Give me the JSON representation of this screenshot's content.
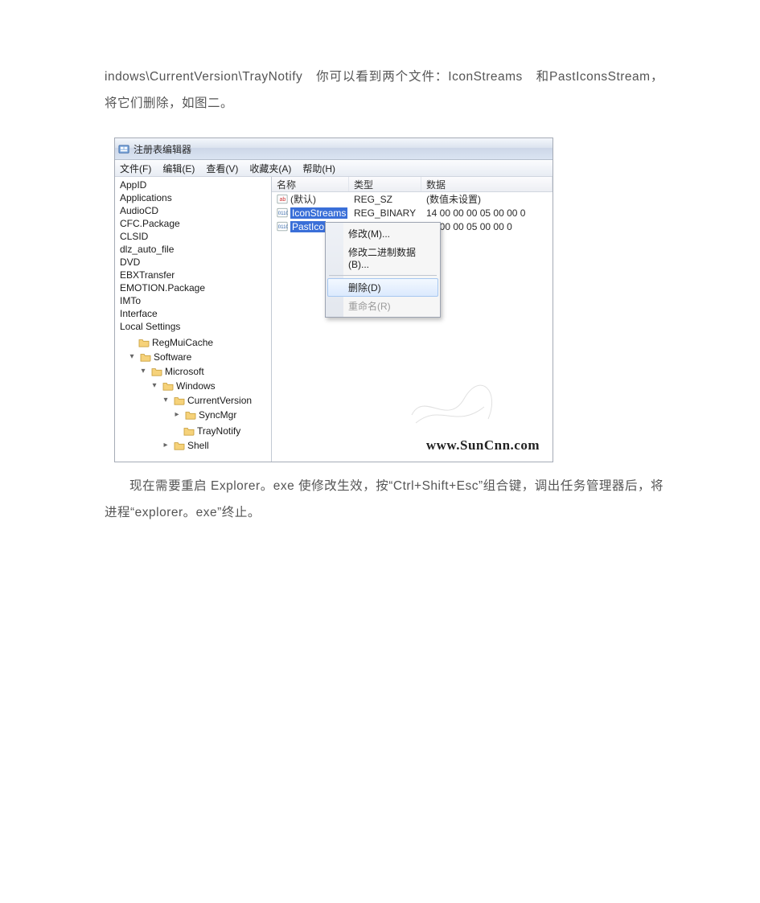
{
  "para1": "indows\\CurrentVersion\\TrayNotify　你可以看到两个文件：IconStreams　和PastIconsStream，将它们删除，如图二。",
  "para2": "现在需要重启 Explorer。exe 使修改生效，按“Ctrl+Shift+Esc”组合键，调出任务管理器后，将进程“explorer。exe”终止。",
  "regedit": {
    "title": "注册表编辑器",
    "menu": {
      "file": "文件(F)",
      "edit": "编辑(E)",
      "view": "查看(V)",
      "fav": "收藏夹(A)",
      "help": "帮助(H)"
    },
    "tree": [
      "AppID",
      "Applications",
      "AudioCD",
      "CFC.Package",
      "CLSID",
      "dlz_auto_file",
      "DVD",
      "EBXTransfer",
      "EMOTION.Package",
      "IMTo",
      "Interface",
      "Local Settings"
    ],
    "treeNested": {
      "regmui": "RegMuiCache",
      "software": "Software",
      "microsoft": "Microsoft",
      "windows": "Windows",
      "currentversion": "CurrentVersion",
      "syncmgr": "SyncMgr",
      "traynotify": "TrayNotify",
      "shell": "Shell"
    },
    "cols": {
      "name": "名称",
      "type": "类型",
      "data": "数据"
    },
    "rows": [
      {
        "name": "(默认)",
        "type": "REG_SZ",
        "data": "(数值未设置)"
      },
      {
        "name": "IconStreams",
        "type": "REG_BINARY",
        "data": "14 00 00 00 05 00 00 0"
      },
      {
        "name": "PastIco",
        "type": "",
        "data": "00 00 00 05 00 00 0"
      }
    ],
    "context": {
      "modify": "修改(M)...",
      "modifyBin": "修改二进制数据(B)...",
      "delete": "删除(D)",
      "rename": "重命名(R)"
    },
    "watermark": "www.SunCnn.com"
  }
}
